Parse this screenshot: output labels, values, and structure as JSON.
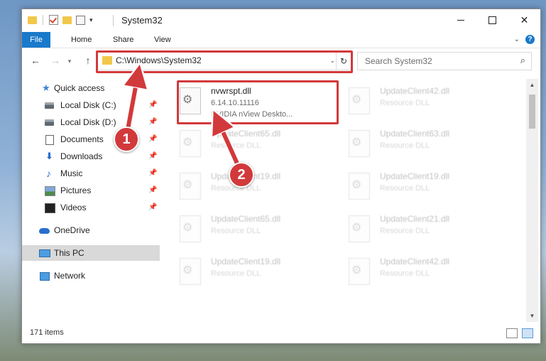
{
  "window": {
    "title": "System32"
  },
  "qat": {
    "customize_arrow": "▾"
  },
  "controls": {
    "minimize": "",
    "maximize": "",
    "close": "✕"
  },
  "ribbon": {
    "file": "File",
    "home": "Home",
    "share": "Share",
    "view": "View",
    "expand": "⌄",
    "help": "?"
  },
  "nav": {
    "back": "←",
    "forward": "→",
    "recent": "▾",
    "up": "↑"
  },
  "address": {
    "path": "C:\\Windows\\System32",
    "dropdown": "⌄",
    "refresh": "↻"
  },
  "search": {
    "placeholder": "Search System32",
    "icon": "⌕"
  },
  "navpane": {
    "items": [
      {
        "label": "Quick access",
        "icon": "star-icon",
        "pinned": false
      },
      {
        "label": "Local Disk (C:)",
        "icon": "drive-icon",
        "pinned": true
      },
      {
        "label": "Local Disk (D:)",
        "icon": "drive-icon",
        "pinned": true
      },
      {
        "label": "Documents",
        "icon": "documents-icon",
        "pinned": true
      },
      {
        "label": "Downloads",
        "icon": "download-icon",
        "pinned": true
      },
      {
        "label": "Music",
        "icon": "music-icon",
        "pinned": true
      },
      {
        "label": "Pictures",
        "icon": "pictures-icon",
        "pinned": true
      },
      {
        "label": "Videos",
        "icon": "videos-icon",
        "pinned": true
      },
      {
        "label": "OneDrive",
        "icon": "onedrive-icon",
        "pinned": false
      },
      {
        "label": "This PC",
        "icon": "pc-icon",
        "pinned": false,
        "selected": true
      },
      {
        "label": "Network",
        "icon": "network-icon",
        "pinned": false
      }
    ],
    "pin_glyph": "📌"
  },
  "files": [
    {
      "name": "nvwrspt.dll",
      "version": "6.14.10.11116",
      "description": "NVIDIA nView Deskto...",
      "highlighted": true
    },
    {
      "name": "UpdateClient42.dll",
      "version": "Resource DLL",
      "description": ""
    },
    {
      "name": "UpdateClient65.dll",
      "version": "Resource DLL",
      "description": ""
    },
    {
      "name": "UpdateClient63.dll",
      "version": "Resource DLL",
      "description": ""
    },
    {
      "name": "UpdateClient19.dll",
      "version": "Resource DLL",
      "description": ""
    },
    {
      "name": "UpdateClient19.dll",
      "version": "Resource DLL",
      "description": ""
    },
    {
      "name": "UpdateClient65.dll",
      "version": "Resource DLL",
      "description": ""
    },
    {
      "name": "UpdateClient21.dll",
      "version": "Resource DLL",
      "description": ""
    },
    {
      "name": "UpdateClient19.dll",
      "version": "Resource DLL",
      "description": ""
    },
    {
      "name": "UpdateClient42.dll",
      "version": "Resource DLL",
      "description": ""
    }
  ],
  "scroll": {
    "up": "▲",
    "down": "▼"
  },
  "status": {
    "count": "171 items"
  },
  "callouts": {
    "one": "1",
    "two": "2"
  },
  "colors": {
    "accent": "#1979ca",
    "highlight": "#d2393b",
    "selected": "#d9d9d9"
  }
}
